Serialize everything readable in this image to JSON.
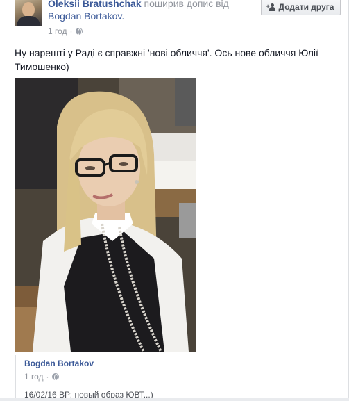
{
  "header": {
    "sharer_name": "Oleksii Bratushchak",
    "action_text": "поширив допис від",
    "original_author": "Bogdan Bortakov.",
    "time": "1 год",
    "privacy_icon": "globe-icon",
    "add_friend_label": "Додати друга",
    "add_friend_icon": "add-friend-icon"
  },
  "post": {
    "text": "Ну нарешті у Раді є справжні 'нові обличчя'. Ось нове обличчя Юлії Тимошенко)"
  },
  "shared": {
    "author": "Bogdan Bortakov",
    "time": "1 год",
    "privacy_icon": "globe-icon",
    "caption": "16/02/16 ВР: новый образ ЮВТ...)"
  },
  "colors": {
    "link": "#3b5998",
    "muted": "#90949c",
    "text": "#141823"
  }
}
